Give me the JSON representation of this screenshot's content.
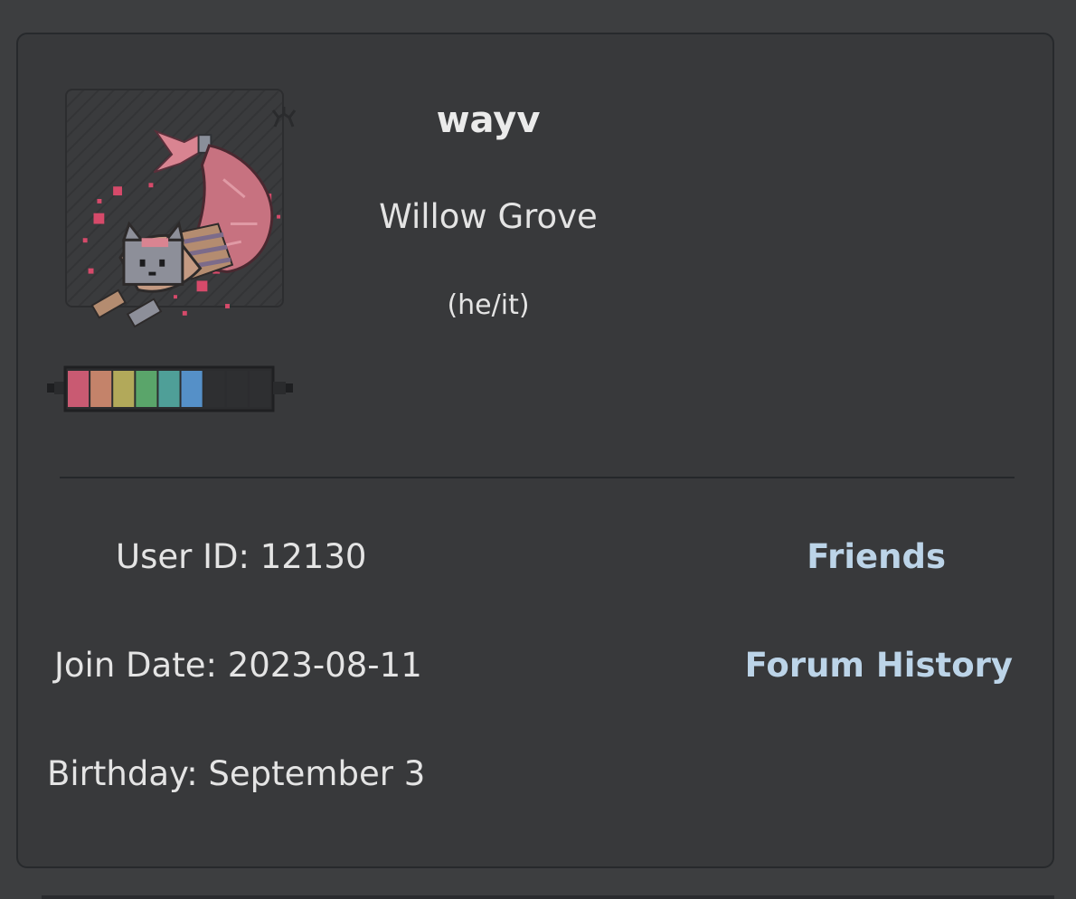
{
  "profile": {
    "username": "wayv",
    "location": "Willow Grove",
    "pronouns": "(he/it)",
    "user_id_text": "User ID: 12130",
    "join_date_text": "Join Date: 2023-08-11",
    "birthday_text": "Birthday: September 3"
  },
  "links": {
    "friends": "Friends",
    "forum_history": "Forum History"
  },
  "badge": {
    "filled_segments": 6,
    "total_segments": 9,
    "segment_colors": [
      "#c95a72",
      "#c4836a",
      "#b2a95a",
      "#5aa56a",
      "#4f9f98",
      "#5590c8"
    ]
  },
  "colors": {
    "background": "#3d3e40",
    "card": "#38393b",
    "link": "#bcd4e8",
    "text": "#e4e4e4"
  },
  "icons": {
    "avatar": "pixel-cat-mermaid-avatar",
    "antler": "antler-icon",
    "badge": "rainbow-progress-badge"
  }
}
